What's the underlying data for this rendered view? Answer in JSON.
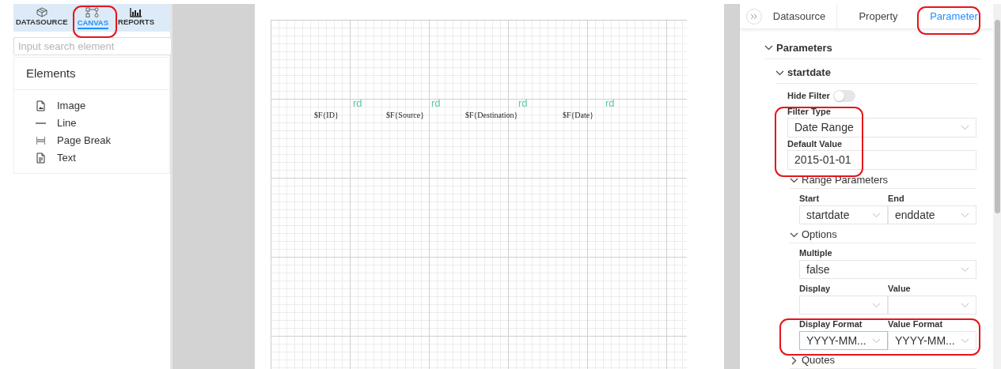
{
  "left_panel": {
    "tabs": [
      {
        "label": "DATASOURCE",
        "kind": "datasource",
        "selected": false
      },
      {
        "label": "CANVAS",
        "kind": "canvas",
        "selected": true
      },
      {
        "label": "REPORTS",
        "kind": "reports",
        "selected": false
      }
    ],
    "search": {
      "placeholder": "Input search element"
    },
    "elements": {
      "title": "Elements",
      "items": [
        {
          "label": "Image",
          "kind": "image"
        },
        {
          "label": "Line",
          "kind": "line"
        },
        {
          "label": "Page Break",
          "kind": "page-break"
        },
        {
          "label": "Text",
          "kind": "text"
        }
      ]
    }
  },
  "canvas": {
    "fields": [
      {
        "text": "$F{ID}",
        "tag": "rd"
      },
      {
        "text": "$F{Source}",
        "tag": "rd"
      },
      {
        "text": "$F{Destination}",
        "tag": "rd"
      },
      {
        "text": "$F{Date}",
        "tag": "rd"
      }
    ]
  },
  "right_panel": {
    "tabs": [
      {
        "label": "Datasource",
        "selected": false
      },
      {
        "label": "Property",
        "selected": false
      },
      {
        "label": "Parameter",
        "selected": true
      }
    ],
    "section": {
      "title": "Parameters",
      "expanded": true,
      "parameter": {
        "name": "startdate",
        "expanded": true,
        "hide_filter": {
          "label": "Hide Filter",
          "on": false
        },
        "filter_type": {
          "label": "Filter Type",
          "kind": "select",
          "value": "Date Range"
        },
        "default_value": {
          "label": "Default Value",
          "kind": "input",
          "value": "2015-01-01"
        },
        "groups": [
          {
            "title": "Range Parameters",
            "expanded": true,
            "fields": [
              {
                "label": "Start",
                "value": "startdate",
                "full_width": false,
                "focused": false
              },
              {
                "label": "End",
                "value": "enddate",
                "full_width": false,
                "focused": false
              }
            ]
          },
          {
            "title": "Options",
            "expanded": true,
            "fields": [
              {
                "label": "Multiple",
                "value": "false",
                "full_width": true,
                "focused": false
              },
              {
                "label": "Display",
                "full_width": false,
                "focused": false
              },
              {
                "label": "Value",
                "full_width": false,
                "focused": false
              },
              {
                "label": "Display Format",
                "value": "YYYY-MM...",
                "full_width": false,
                "focused": true
              },
              {
                "label": "Value Format",
                "value": "YYYY-MM...",
                "full_width": false,
                "focused": false
              }
            ]
          },
          {
            "title": "Quotes",
            "expanded": false
          }
        ]
      }
    }
  }
}
